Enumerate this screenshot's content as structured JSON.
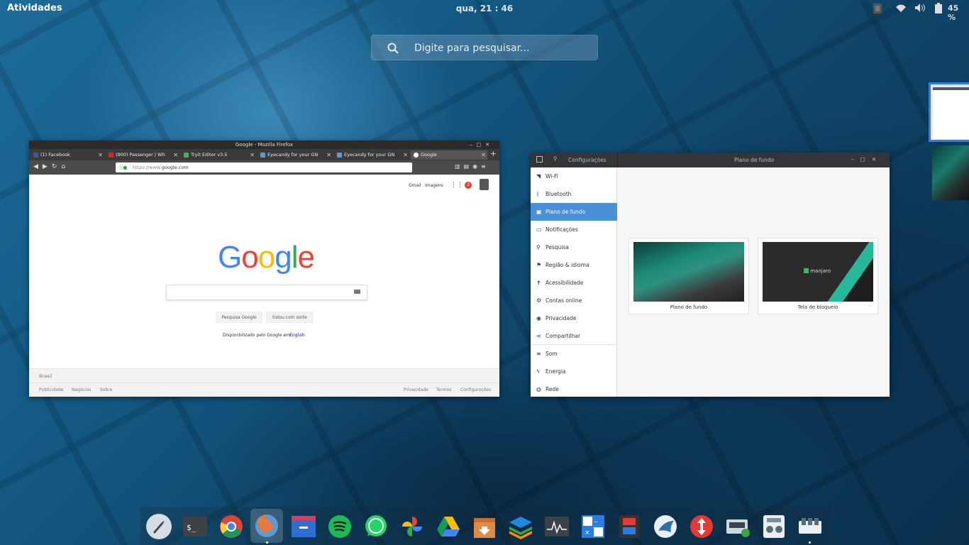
{
  "topbar": {
    "activities": "Atividades",
    "clock": "qua, 21 : 46",
    "battery": "45 %"
  },
  "search": {
    "placeholder": "Digite para pesquisar..."
  },
  "firefox": {
    "title": "Google - Mozilla Firefox",
    "tabs": [
      "(1) Facebook",
      "(900) Passenger | Wh",
      "Tryit Editor v3.5",
      "Eyecandy for your GN",
      "Eyecandy for your GN",
      "Google"
    ],
    "url_prefix": "https://www.",
    "url_domain": "google.com",
    "page": {
      "gmail": "Gmail",
      "images": "Imagens",
      "notif_count": "2",
      "logo": "Google",
      "btn_search": "Pesquisa Google",
      "btn_lucky": "Estou com sorte",
      "offered_in": "Disponibilizado pelo Google em:",
      "lang_link": "English",
      "country": "Brasil",
      "footer_left": [
        "Publicidade",
        "Negócios",
        "Sobre"
      ],
      "footer_right": [
        "Privacidade",
        "Termos",
        "Configurações"
      ]
    }
  },
  "settings": {
    "title": "Configurações",
    "panel_title": "Plano de fundo",
    "items": [
      "Wi-Fi",
      "Bluetooth",
      "Plano de fundo",
      "Notificações",
      "Pesquisa",
      "Região & idioma",
      "Acessibilidade",
      "Contas online",
      "Privacidade",
      "Compartilhar",
      "Som",
      "Energia",
      "Rede"
    ],
    "selected": "Plano de fundo",
    "cards": [
      "Plano de fundo",
      "Tela de bloqueio"
    ],
    "lock_brand": "manjaro"
  },
  "dock_apps": [
    "launcher",
    "terminal",
    "chrome",
    "firefox",
    "files",
    "spotify",
    "whatsapp",
    "photos",
    "google-drive",
    "archive-manager",
    "layers",
    "system-monitor",
    "calculator",
    "video",
    "kodi-bird",
    "transmission",
    "cassette",
    "mixer",
    "settings-tool"
  ]
}
